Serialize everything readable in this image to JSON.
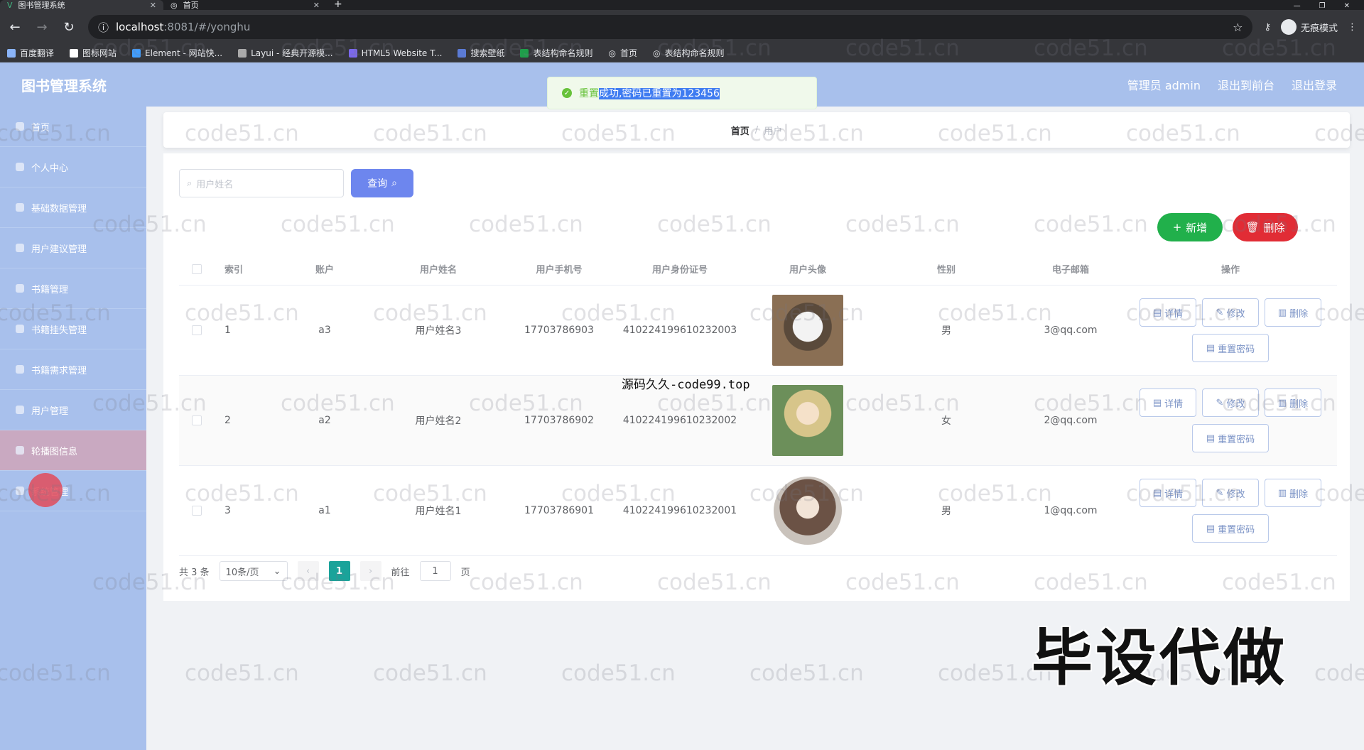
{
  "browser": {
    "tabs": [
      {
        "title": "图书管理系统",
        "active": true
      },
      {
        "title": "首页",
        "active": false
      }
    ],
    "url_host": "localhost",
    "url_path": ":8081/#/yonghu",
    "incognito_label": "无痕模式",
    "bookmarks": [
      "百度翻译",
      "图标网站",
      "Element - 网站快...",
      "Layui - 经典开源模...",
      "HTML5 Website T...",
      "搜索壁纸",
      "表结构命名规则",
      "首页",
      "表结构命名规则"
    ]
  },
  "app": {
    "title": "图书管理系统",
    "header_links": [
      "管理员 admin",
      "退出到前台",
      "退出登录"
    ]
  },
  "toast": {
    "prefix": "重置",
    "selected_text": "成功,密码已重置为123456"
  },
  "sidebar": {
    "items": [
      "首页",
      "个人中心",
      "基础数据管理",
      "用户建议管理",
      "书籍管理",
      "书籍挂失管理",
      "书籍需求管理",
      "用户管理",
      "轮播图信息",
      "系统管理"
    ]
  },
  "breadcrumb": {
    "home": "首页",
    "sep": "/",
    "current": "用户"
  },
  "search": {
    "placeholder": "用户姓名",
    "button": "查询"
  },
  "actions": {
    "add": "新增",
    "delete": "删除"
  },
  "table": {
    "headers": [
      "索引",
      "账户",
      "用户姓名",
      "用户手机号",
      "用户身份证号",
      "用户头像",
      "性别",
      "电子邮箱",
      "操作"
    ],
    "rows": [
      {
        "idx": "1",
        "account": "a3",
        "name": "用户姓名3",
        "phone": "17703786903",
        "idcard": "410224199610232003",
        "sex": "男",
        "email": "3@qq.com"
      },
      {
        "idx": "2",
        "account": "a2",
        "name": "用户姓名2",
        "phone": "17703786902",
        "idcard": "410224199610232002",
        "sex": "女",
        "email": "2@qq.com"
      },
      {
        "idx": "3",
        "account": "a1",
        "name": "用户姓名1",
        "phone": "17703786901",
        "idcard": "410224199610232001",
        "sex": "男",
        "email": "1@qq.com"
      }
    ],
    "ops": {
      "detail": "详情",
      "edit": "修改",
      "delete": "删除",
      "reset": "重置密码"
    }
  },
  "pager": {
    "total": "共 3 条",
    "size": "10条/页",
    "page": "1",
    "goto_label": "前往",
    "goto_value": "1",
    "page_suffix": "页"
  },
  "overlay": {
    "caption": "源码久久-code99.top",
    "stamp": "毕设代做",
    "watermark": "code51.cn"
  }
}
